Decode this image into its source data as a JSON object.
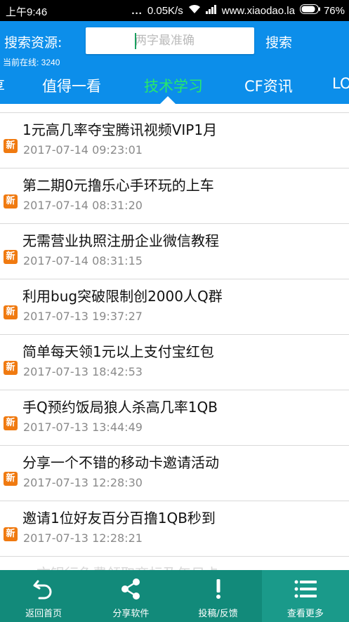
{
  "status_bar": {
    "time": "上午9:46",
    "dots": "...",
    "speed": "0.05K/s",
    "domain": "www.xiaodao.la",
    "battery": "76%"
  },
  "header": {
    "search_label": "搜索资源:",
    "search_placeholder": "两字最准确",
    "search_button": "搜索",
    "online_text": "当前在线: 3240"
  },
  "tabs": [
    "享",
    "值得一看",
    "技术学习",
    "CF资讯",
    "LO"
  ],
  "active_tab": "技术学习",
  "badge_text": "新",
  "items": [
    {
      "title": "1元高几率夺宝腾讯视频VIP1月",
      "date": "2017-07-14 09:23:01"
    },
    {
      "title": "第二期0元撸乐心手环玩的上车",
      "date": "2017-07-14 08:31:20"
    },
    {
      "title": "无需营业执照注册企业微信教程",
      "date": "2017-07-14 08:31:15"
    },
    {
      "title": "利用bug突破限制创2000人Q群",
      "date": "2017-07-13 19:37:27"
    },
    {
      "title": "简单每天领1元以上支付宝红包",
      "date": "2017-07-13 18:42:53"
    },
    {
      "title": "手Q预约饭局狼人杀高几率1QB",
      "date": "2017-07-13 13:44:49"
    },
    {
      "title": "分享一个不错的移动卡邀请活动",
      "date": "2017-07-13 12:28:30"
    },
    {
      "title": "邀请1位好友百分百撸1QB秒到",
      "date": "2017-07-13 12:28:21"
    },
    {
      "title": "一文银行免费领取商标及年日卡",
      "date": ""
    }
  ],
  "bottom_nav": [
    {
      "label": "返回首页",
      "icon": "undo-icon"
    },
    {
      "label": "分享软件",
      "icon": "share-icon"
    },
    {
      "label": "投稿/反馈",
      "icon": "exclamation-icon"
    },
    {
      "label": "查看更多",
      "icon": "list-icon"
    }
  ],
  "colors": {
    "header_blue": "#0c8eea",
    "active_tab_green": "#27e86b",
    "badge_orange": "#f07a10",
    "nav_teal": "#128a7a"
  }
}
